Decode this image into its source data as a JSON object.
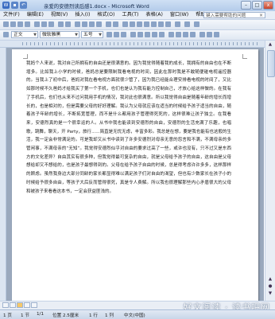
{
  "window": {
    "title": "亲爱的安德烈读后感1.docx - Microsoft Word",
    "minimize_glyph": "–",
    "maximize_glyph": "□",
    "close_glyph": "x"
  },
  "menu": {
    "items": [
      "文件(F)",
      "编辑(E)",
      "视图(V)",
      "插入(I)",
      "格式(O)",
      "工具(T)",
      "表格(A)",
      "窗口(W)",
      "帮助(H)"
    ],
    "help_placeholder": "键入需要帮助的问题"
  },
  "format_bar": {
    "style": "正文",
    "font": "微软雅黑",
    "size": "五号"
  },
  "document": {
    "body": "我妈个人来说，我对自己所拥有的自由还是很满意的。因为我觉得随着我的成长，我拥有的自由也在不断增多。比如我上小学的时候，爸妈总是要限制我看电视的时间，因此在那时我是不敢随便碰电视遥控器的。当我上了初中后，爸妈对我在看电视方面就很少管了，因为我已经能合理安排看电视的时间了，又比如那时候不久爸妈才给我买了第一个手机，也们也是认为我有能力控制自己，才放心给这样做的。在我有了手机后，也们也从来不过问我用手机的情况，我对此也很满意。所以我觉得自由是随着年龄的增长而增长的，也是相对的，但是需要父母的好好理解。我认为父母就应该在适当的时候给予孩子适当的自由，随着孩子年龄的增长，不断拓宽管理，而不是什么都用孩子管理得死死的，这样很难让孩子独立。在我看来，安德烈真的是一个很幸运的人。从书中我也能读到安德烈的自由，安德烈的生活充满了乐趣，也唱歌，跳舞，聊天，开 Party，旅行......简直是无忧无虑，丰富多彩。我总是在想，要是我也能有也这般的生活，我一定会非常满足的。可是我却又从书中读到了许多安德烈对母亲无意的怨言和不满，不满母亲的多管闲事，不满母亲的“无知”。我觉得安德烈似乎对自由的要求过高了一些，或许也没有，只不过又是东西方的文化差异？自由其实有很多种，但我觉得最可复杂的自由，就是父母给予孩子的自由，这自由是父母想给却又不想给的，也是孩子最想得到的。父母在给予孩子自由的时候，总是得考虑许许多多，这样那样的顾虑。虽然我身边大部分同龄的家长都显得难以满足孩子们对自由的渴望，但也有少数家长在孩子小的时候给予很多自由，等孩子大后反而管得很死，真是令人费解。所以我也很理解那些内心矛盾很大的父母和被孩子来看看这本书，一定会获益匪浅的。"
  },
  "status": {
    "page": "1 页",
    "section": "1 节",
    "pages": "1/1",
    "position": "位置 2.5厘米",
    "line": "1 行",
    "column": "1 列",
    "language": "中文(中国)"
  },
  "watermark": "好文阅读 · 读书吧网"
}
